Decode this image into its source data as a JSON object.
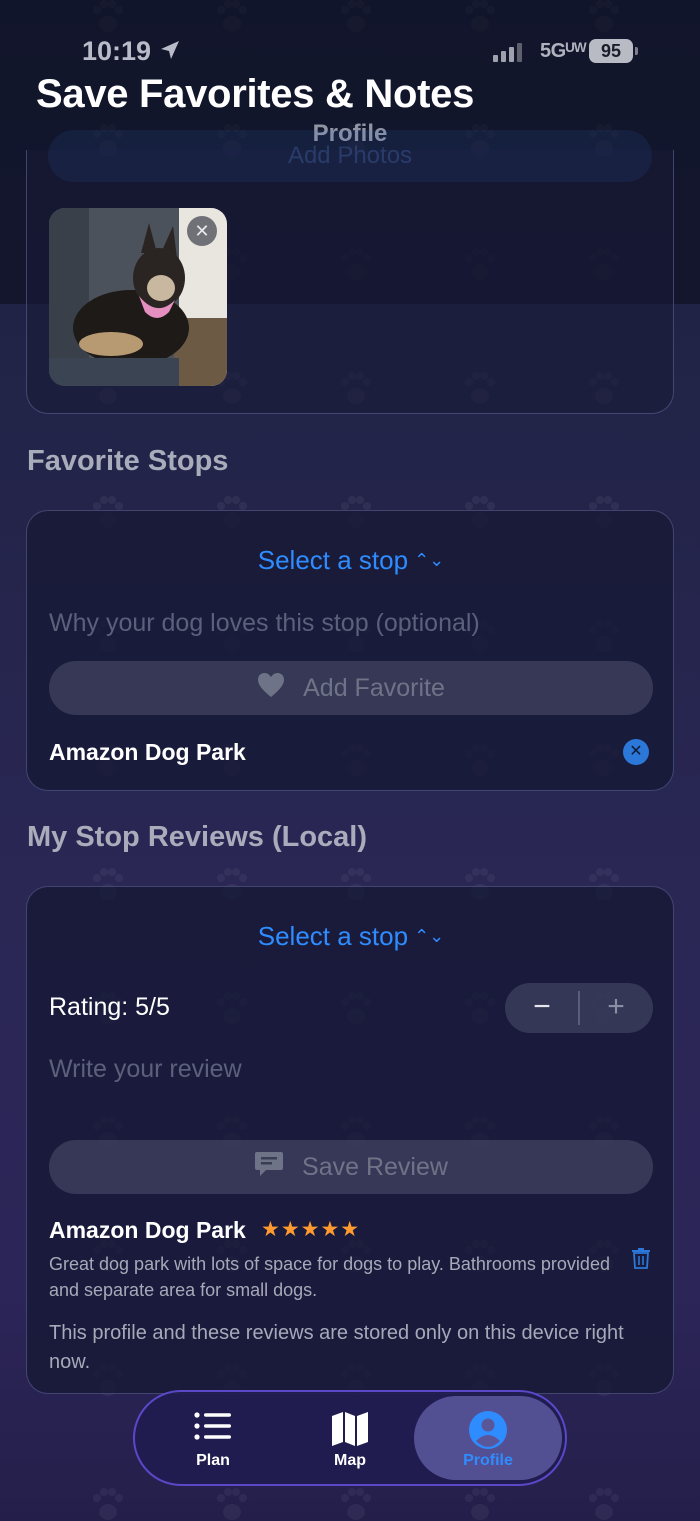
{
  "status_bar": {
    "time": "10:19",
    "network": "5Gᵁᵂ",
    "battery": "95"
  },
  "overlay": {
    "headline": "Save Favorites & Notes"
  },
  "header": {
    "title": "Profile",
    "add_photos_label": "Add Photos"
  },
  "favorites": {
    "section_title": "Favorite Stops",
    "picker_label": "Select a stop",
    "note_placeholder": "Why your dog loves this stop (optional)",
    "add_button_label": "Add Favorite",
    "items": [
      {
        "name": "Amazon Dog Park"
      }
    ]
  },
  "reviews": {
    "section_title": "My Stop Reviews (Local)",
    "picker_label": "Select a stop",
    "rating_label": "Rating: 5/5",
    "rating_value": 5,
    "review_placeholder": "Write your review",
    "save_button_label": "Save Review",
    "items": [
      {
        "name": "Amazon Dog Park",
        "stars": "★★★★★",
        "text": "Great dog park with lots of space for dogs to play. Bathrooms provided and separate area for small dogs."
      }
    ],
    "footnote": "This profile and these reviews are stored only on this device right now."
  },
  "tabbar": {
    "tabs": [
      {
        "label": "Plan",
        "icon": "list-icon",
        "active": false
      },
      {
        "label": "Map",
        "icon": "map-icon",
        "active": false
      },
      {
        "label": "Profile",
        "icon": "person-icon",
        "active": true
      }
    ]
  },
  "colors": {
    "accent": "#2f8cff",
    "star": "#ff9a2e",
    "tab_border": "#5a48c8"
  }
}
